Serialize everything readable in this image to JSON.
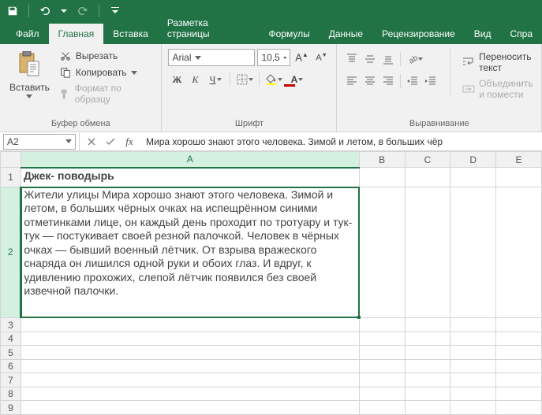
{
  "titlebar": {
    "save_icon": "save",
    "undo_icon": "undo",
    "redo_icon": "redo"
  },
  "tabs": {
    "file": "Файл",
    "home": "Главная",
    "insert": "Вставка",
    "page_layout": "Разметка страницы",
    "formulas": "Формулы",
    "data": "Данные",
    "review": "Рецензирование",
    "view": "Вид",
    "help": "Спра"
  },
  "ribbon": {
    "clipboard": {
      "paste": "Вставить",
      "cut": "Вырезать",
      "copy": "Копировать",
      "format_painter": "Формат по образцу",
      "group_label": "Буфер обмена"
    },
    "font": {
      "name": "Arial",
      "size": "10,5",
      "group_label": "Шрифт"
    },
    "alignment": {
      "wrap_text": "Переносить текст",
      "merge": "Объединить и помести",
      "group_label": "Выравнивание"
    }
  },
  "namebox": {
    "cell_ref": "A2",
    "formula_bar": "Мира хорошо знают этого человека. Зимой и летом, в больших чёр"
  },
  "columns": [
    "A",
    "B",
    "C",
    "D",
    "E"
  ],
  "cells": {
    "a1": "Джек- поводырь",
    "a2": "Жители улицы\nМира хорошо знают этого человека. Зимой и летом, в больших чёрных очках на испещрённом синими отметинками лице, он каждый день проходит по тротуару и тук-тук — постукивает своей резной палочкой. Человек в чёрных очках — бывший военный лётчик. От взрыва вражеского снаряда он лишился одной руки и обоих глаз. И вдруг, к удивлению прохожих, слепой лётчик появился без своей извечной палочки."
  },
  "rows": [
    1,
    2,
    3,
    4,
    5,
    6,
    7,
    8,
    9
  ]
}
